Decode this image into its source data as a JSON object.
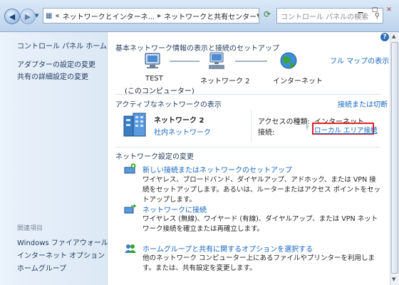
{
  "addressbar": {
    "breadcrumb_prefix": "«",
    "crumb1": "ネットワークとインターネ...",
    "crumb2": "ネットワークと共有センター",
    "search_placeholder": "コントロール パネルの検索"
  },
  "sidebar": {
    "home": "コントロール パネル ホーム",
    "items": [
      "アダプターの設定の変更",
      "共有の詳細設定の変更"
    ],
    "see_also": "関連項目",
    "related": [
      "Windows ファイアウォール",
      "インターネット オプション",
      "ホームグループ"
    ]
  },
  "main": {
    "title": "基本ネットワーク情報の表示と接続のセットアップ",
    "full_map": "フル マップの表示",
    "map": {
      "node1": "TEST",
      "node1_sub": "(このコンピューター)",
      "node2": "ネットワーク 2",
      "node3": "インターネット"
    },
    "active_title": "アクティブなネットワークの表示",
    "connect_link": "接続または切断",
    "network": {
      "name": "ネットワーク 2",
      "type": "社内ネットワーク",
      "access_label": "アクセスの種類:",
      "access_value": "インターネット",
      "conn_label": "接続:",
      "conn_value": "ローカル エリア接続"
    },
    "change_title": "ネットワーク設定の変更",
    "tasks": [
      {
        "title": "新しい接続またはネットワークのセットアップ",
        "desc": "ワイヤレス、ブロードバンド、ダイヤルアップ、アドホック、または VPN 接続をセットアップします。あるいは、ルーターまたはアクセス ポイントをセットアップします。"
      },
      {
        "title": "ネットワークに接続",
        "desc": "ワイヤレス (無線)、ワイヤード (有線)、ダイヤルアップ、または VPN ネットワーク接続を確立または再確立します。"
      },
      {
        "title": "ホームグループと共有に関するオプションを選択する",
        "desc": "他のネットワーク コンピューター上にあるファイルやプリンターを利用します。または、共有設定を変更します。"
      }
    ]
  },
  "colors": {
    "highlight": "#e02020",
    "link": "#1565c0"
  }
}
